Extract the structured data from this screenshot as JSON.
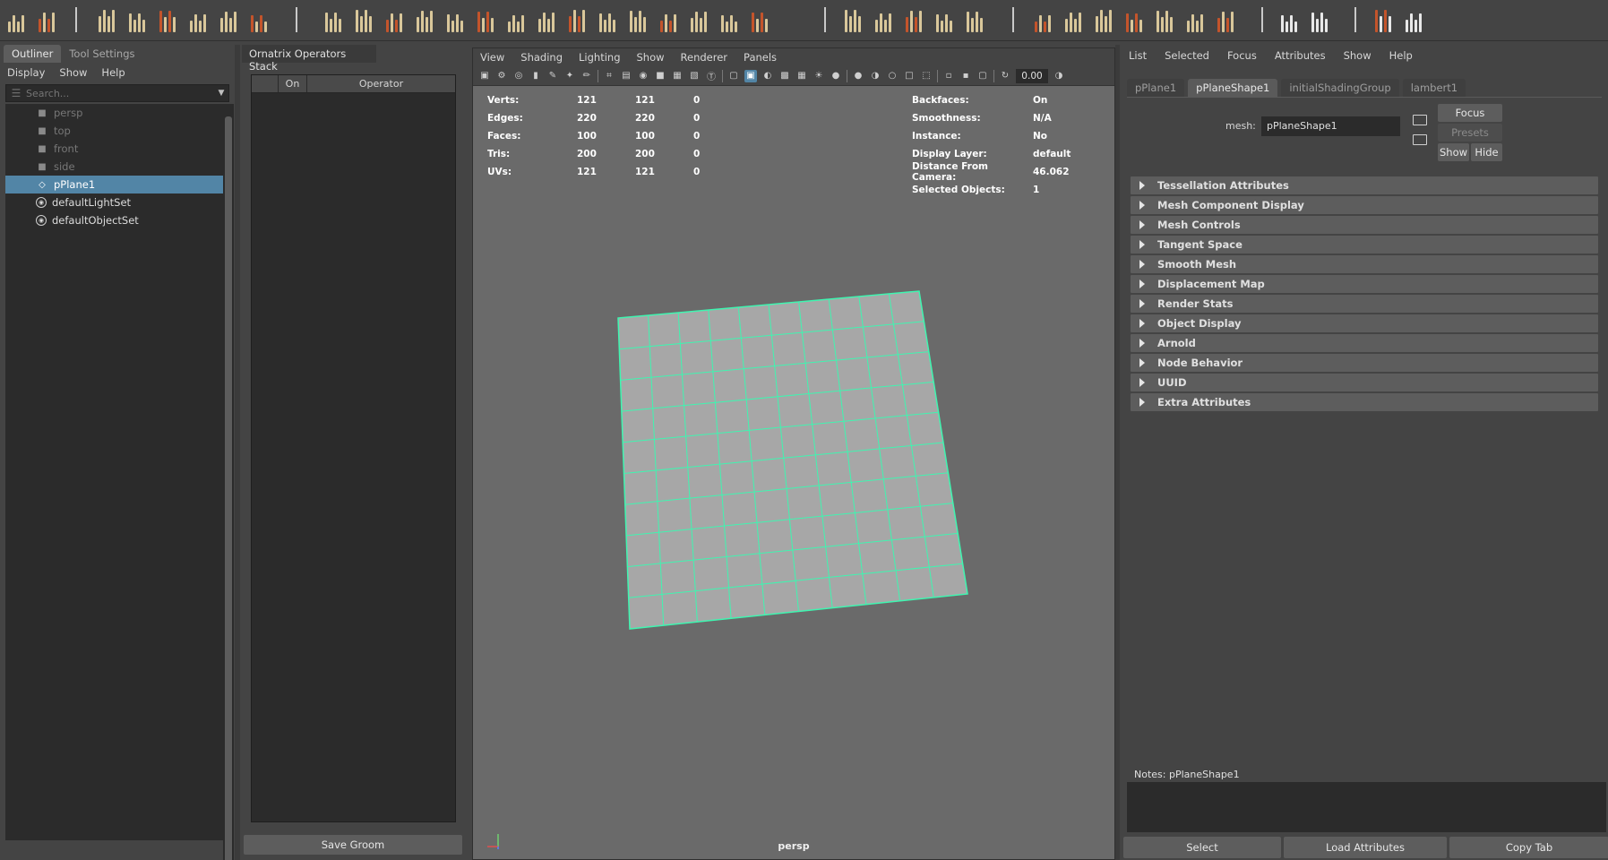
{
  "outliner": {
    "tabs": [
      "Outliner",
      "Tool Settings"
    ],
    "menu": [
      "Display",
      "Show",
      "Help"
    ],
    "search_placeholder": "Search...",
    "items": [
      {
        "label": "persp",
        "icon": "camera-icon",
        "state": "dim"
      },
      {
        "label": "top",
        "icon": "camera-icon",
        "state": "dim"
      },
      {
        "label": "front",
        "icon": "camera-icon",
        "state": "dim"
      },
      {
        "label": "side",
        "icon": "camera-icon",
        "state": "dim"
      },
      {
        "label": "pPlane1",
        "icon": "mesh-icon",
        "state": "selected"
      },
      {
        "label": "defaultLightSet",
        "icon": "set-icon",
        "state": "normal"
      },
      {
        "label": "defaultObjectSet",
        "icon": "set-icon",
        "state": "normal"
      }
    ]
  },
  "ornatrix": {
    "title": "Ornatrix Operators Stack",
    "col_on": "On",
    "col_operator": "Operator",
    "save_button": "Save Groom"
  },
  "viewport": {
    "menu": [
      "View",
      "Shading",
      "Lighting",
      "Show",
      "Renderer",
      "Panels"
    ],
    "field_value": "0.00",
    "camera": "persp",
    "hud_left": [
      {
        "label": "Verts:",
        "a": "121",
        "b": "121",
        "c": "0"
      },
      {
        "label": "Edges:",
        "a": "220",
        "b": "220",
        "c": "0"
      },
      {
        "label": "Faces:",
        "a": "100",
        "b": "100",
        "c": "0"
      },
      {
        "label": "Tris:",
        "a": "200",
        "b": "200",
        "c": "0"
      },
      {
        "label": "UVs:",
        "a": "121",
        "b": "121",
        "c": "0"
      }
    ],
    "hud_right": [
      {
        "label": "Backfaces:",
        "value": "On"
      },
      {
        "label": "Smoothness:",
        "value": "N/A"
      },
      {
        "label": "Instance:",
        "value": "No"
      },
      {
        "label": "Display Layer:",
        "value": "default"
      },
      {
        "label": "Distance From Camera:",
        "value": "46.062"
      },
      {
        "label": "Selected Objects:",
        "value": "1"
      }
    ],
    "grid_color": "#3ff5b0",
    "plane_color": "#a7a7a7"
  },
  "attribute_editor": {
    "menu": [
      "List",
      "Selected",
      "Focus",
      "Attributes",
      "Show",
      "Help"
    ],
    "tabs": [
      "pPlane1",
      "pPlaneShape1",
      "initialShadingGroup",
      "lambert1"
    ],
    "mesh_label": "mesh:",
    "mesh_value": "pPlaneShape1",
    "focus_button": "Focus",
    "presets_button": "Presets",
    "show_button": "Show",
    "hide_button": "Hide",
    "sections": [
      "Tessellation Attributes",
      "Mesh Component Display",
      "Mesh Controls",
      "Tangent Space",
      "Smooth Mesh",
      "Displacement Map",
      "Render Stats",
      "Object Display",
      "Arnold",
      "Node Behavior",
      "UUID",
      "Extra Attributes"
    ],
    "notes_label": "Notes:  pPlaneShape1",
    "bottom_buttons": [
      "Select",
      "Load Attributes",
      "Copy Tab"
    ]
  },
  "colors": {
    "selection": "#5285a6",
    "accent_brown": "#c4542b"
  }
}
